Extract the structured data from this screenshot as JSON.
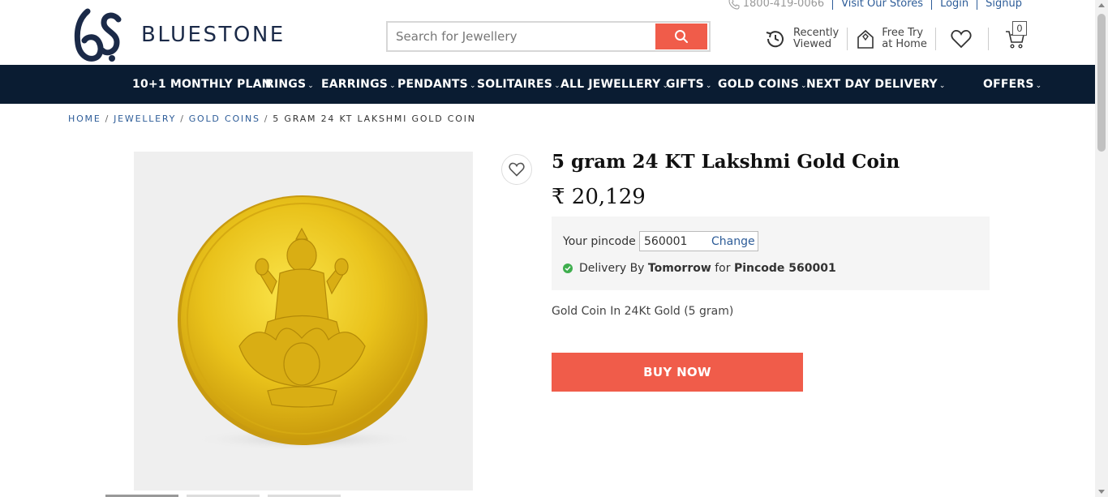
{
  "brand": {
    "name": "BLUESTONE"
  },
  "top_links": {
    "phone": "1800-419-0066",
    "stores": "Visit Our Stores",
    "login": "Login",
    "signup": "Signup"
  },
  "search": {
    "placeholder": "Search for Jewellery"
  },
  "header_actions": {
    "recently_viewed": [
      "Recently",
      "Viewed"
    ],
    "free_try": [
      "Free Try",
      "at Home"
    ],
    "cart_count": "0"
  },
  "nav": {
    "items": [
      {
        "label": "10+1 MONTHLY PLAN",
        "has_dropdown": false
      },
      {
        "label": "RINGS",
        "has_dropdown": true
      },
      {
        "label": "EARRINGS",
        "has_dropdown": true
      },
      {
        "label": "PENDANTS",
        "has_dropdown": true
      },
      {
        "label": "SOLITAIRES",
        "has_dropdown": true
      },
      {
        "label": "ALL JEWELLERY",
        "has_dropdown": true
      },
      {
        "label": "GIFTS",
        "has_dropdown": true
      },
      {
        "label": "GOLD COINS",
        "has_dropdown": true
      },
      {
        "label": "NEXT DAY DELIVERY",
        "has_dropdown": true
      },
      {
        "label": "OFFERS",
        "has_dropdown": true
      }
    ]
  },
  "breadcrumb": {
    "home": "HOME",
    "jewellery": "JEWELLERY",
    "gold_coins": "GOLD COINS",
    "current": "5 GRAM 24 KT LAKSHMI GOLD COIN"
  },
  "product": {
    "title": "5 gram 24 KT Lakshmi Gold Coin",
    "price": "₹ 20,129",
    "pincode_label": "Your pincode",
    "pincode_value": "560001",
    "change_label": "Change",
    "delivery_prefix": "Delivery By",
    "delivery_when": "Tomorrow",
    "delivery_for": "for",
    "delivery_pincode": "Pincode 560001",
    "description": "Gold Coin In 24Kt Gold (5 gram)",
    "buy_label": "BUY NOW"
  },
  "colors": {
    "navy": "#0a1c32",
    "accent": "#f05c4a",
    "link": "#2d5c98",
    "gold": "#e8c21a"
  }
}
